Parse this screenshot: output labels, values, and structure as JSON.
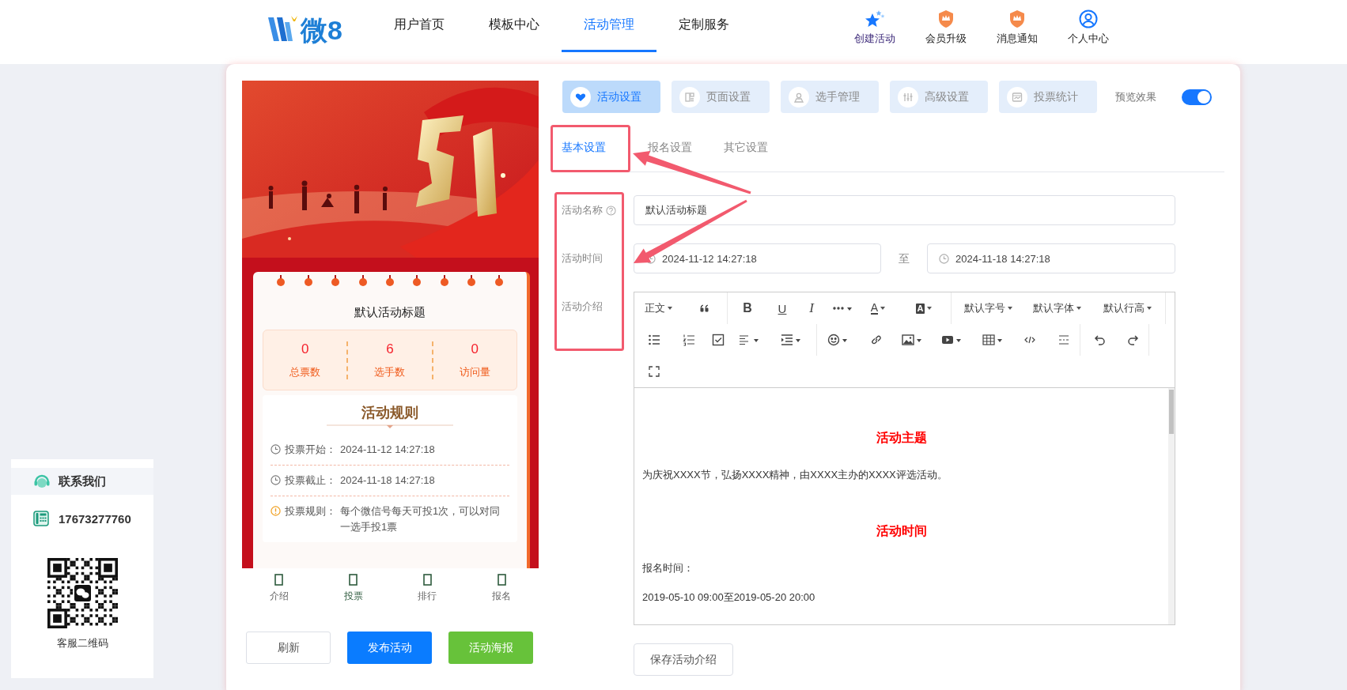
{
  "header": {
    "logo": "微8",
    "nav": [
      {
        "label": "用户首页",
        "selected": false
      },
      {
        "label": "模板中心",
        "selected": false
      },
      {
        "label": "活动管理",
        "selected": true
      },
      {
        "label": "定制服务",
        "selected": false
      }
    ],
    "actions": [
      {
        "label": "创建活动"
      },
      {
        "label": "会员升级"
      },
      {
        "label": "消息通知"
      },
      {
        "label": "个人中心"
      }
    ]
  },
  "preview": {
    "title": "默认活动标题",
    "stats": [
      {
        "value": "0",
        "label": "总票数"
      },
      {
        "value": "6",
        "label": "选手数"
      },
      {
        "value": "0",
        "label": "访问量"
      }
    ],
    "rules_heading": "活动规则",
    "rules": [
      {
        "kind": "time",
        "label": "投票开始：",
        "value": "2024-11-12 14:27:18"
      },
      {
        "kind": "time",
        "label": "投票截止：",
        "value": "2024-11-18 14:27:18"
      },
      {
        "kind": "notice",
        "label": "投票规则：",
        "value": "每个微信号每天可投1次，可以对同一选手投1票"
      }
    ],
    "tabbar": [
      {
        "label": "介绍",
        "selected": false
      },
      {
        "label": "投票",
        "selected": true
      },
      {
        "label": "排行",
        "selected": false
      },
      {
        "label": "报名",
        "selected": false
      }
    ],
    "buttons": [
      {
        "label": "刷新",
        "kind": "plain"
      },
      {
        "label": "发布活动",
        "kind": "primary"
      },
      {
        "label": "活动海报",
        "kind": "success"
      }
    ]
  },
  "contact": {
    "title": "联系我们",
    "phone": "17673277760",
    "qr_caption": "客服二维码"
  },
  "settings_tabs": [
    {
      "label": "活动设置",
      "selected": true
    },
    {
      "label": "页面设置",
      "selected": false
    },
    {
      "label": "选手管理",
      "selected": false
    },
    {
      "label": "高级设置",
      "selected": false
    },
    {
      "label": "投票统计",
      "selected": false
    }
  ],
  "preview_toggle": {
    "label": "预览效果",
    "on": true
  },
  "sub_tabs": [
    {
      "label": "基本设置",
      "selected": true
    },
    {
      "label": "报名设置",
      "selected": false
    },
    {
      "label": "其它设置",
      "selected": false
    }
  ],
  "form": {
    "name_label": "活动名称",
    "name_value": "默认活动标题",
    "time_label": "活动时间",
    "start": "2024-11-12 14:27:18",
    "to": "至",
    "end": "2024-11-18 14:27:18",
    "intro_label": "活动介绍"
  },
  "editor": {
    "format": "正文",
    "bold": "B",
    "underline": "U",
    "italic": "I",
    "font_color": "A",
    "background_color": "A",
    "font_size": "默认字号",
    "font_family": "默认字体",
    "line_height": "默认行高",
    "content": [
      {
        "kind": "heading",
        "text": "活动主题"
      },
      {
        "kind": "paragraph",
        "text": "为庆祝XXXX节，弘扬XXXX精神，由XXXX主办的XXXX评选活动。"
      },
      {
        "kind": "heading",
        "text": "活动时间"
      },
      {
        "kind": "paragraph",
        "text": "报名时间："
      },
      {
        "kind": "paragraph",
        "text": "2019-05-10 09:00至2019-05-20 20:00"
      }
    ]
  },
  "save_button": "保存活动介绍"
}
